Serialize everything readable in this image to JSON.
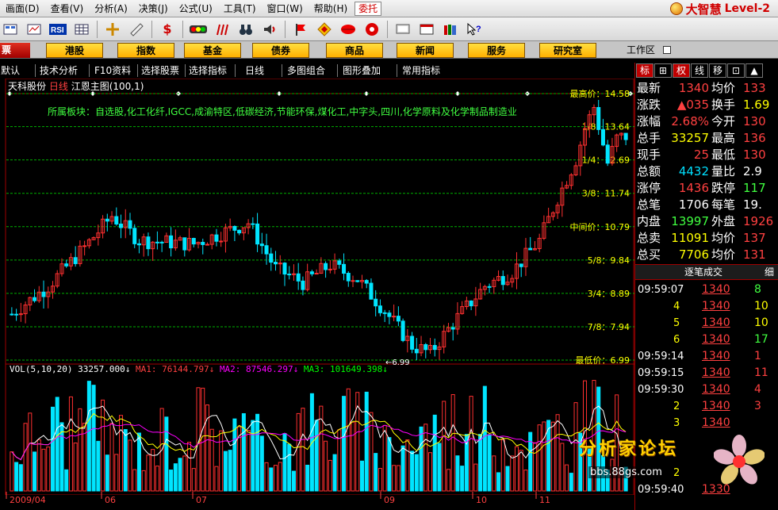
{
  "menu": [
    "画面(D)",
    "查看(V)",
    "分析(A)",
    "决策(J)",
    "公式(U)",
    "工具(T)",
    "窗口(W)",
    "帮助(H)"
  ],
  "menu_special": "委托",
  "brand": {
    "name": "大智慧",
    "edition": "Level-2"
  },
  "toolbar_icons": [
    "layout-icon",
    "ta-icon",
    "rsi-icon",
    "table-icon",
    "crosshair-icon",
    "ruler-icon",
    "dollar-icon",
    "traffic-light-icon",
    "bars-icon",
    "binoculars-icon",
    "speaker-icon",
    "flag-icon",
    "diamond-icon",
    "lips-icon",
    "disc-icon",
    "monitor-icon",
    "book-icon",
    "help-cursor-icon"
  ],
  "nav": {
    "left_label": "票",
    "buttons": [
      "港股",
      "指数",
      "基金",
      "债券",
      "商品",
      "新闻",
      "服务",
      "研究室"
    ],
    "work_zone": "工作区"
  },
  "subbar": [
    "默认",
    "技术分析",
    "F10资料",
    "选择股票",
    "选择指标",
    "日线",
    "多图组合",
    "图形叠加",
    "常用指标"
  ],
  "chart_title": {
    "stock": "天科股份",
    "period": "日线",
    "indicator": "江恩主图(100,1)"
  },
  "sector": "所属板块：自选股,化工化纤,IGCC,成渝特区,低碳经济,节能环保,煤化工,中字头,四川,化学原料及化学制品制造业",
  "gann_levels": [
    {
      "label": "最高价",
      "value": "14.58"
    },
    {
      "label": "1/8",
      "value": "13.64"
    },
    {
      "label": "1/4",
      "value": "12.69"
    },
    {
      "label": "3/8",
      "value": "11.74"
    },
    {
      "label": "中间价",
      "value": "10.79"
    },
    {
      "label": "5/8",
      "value": "9.84"
    },
    {
      "label": "3/4",
      "value": "8.89"
    },
    {
      "label": "7/8",
      "value": "7.94"
    },
    {
      "label": "最低价",
      "value": "6.99"
    }
  ],
  "low_marker": "6.99",
  "vol_legend": {
    "vol": "VOL(5,10,20)",
    "vol_value": "33257.000↓",
    "ma1": "MA1: 76144.797↓",
    "ma2": "MA2: 87546.297↓",
    "ma3": "MA3: 101649.398↓"
  },
  "x_labels": [
    "2009/04",
    "06",
    "07",
    "09",
    "10",
    "11"
  ],
  "right_tabs": [
    "标",
    "⊞",
    "权",
    "线",
    "移",
    "⊡",
    "▲"
  ],
  "quote": [
    {
      "l1": "最新",
      "v1": "1340",
      "c1": "#ff4040",
      "l2": "均价",
      "v2": "133",
      "c2": "#ff4040"
    },
    {
      "l1": "涨跌",
      "v1": "▲035",
      "c1": "#ff4040",
      "l2": "换手",
      "v2": "1.69",
      "c2": "#ffff00"
    },
    {
      "l1": "涨幅",
      "v1": "2.68%",
      "c1": "#ff4040",
      "l2": "今开",
      "v2": "130",
      "c2": "#ff4040"
    },
    {
      "l1": "总手",
      "v1": "33257",
      "c1": "#ffff00",
      "l2": "最高",
      "v2": "136",
      "c2": "#ff4040"
    },
    {
      "l1": "现手",
      "v1": "25",
      "c1": "#ff4040",
      "l2": "最低",
      "v2": "130",
      "c2": "#ff4040"
    },
    {
      "l1": "总额",
      "v1": "4432",
      "c1": "#00e0ff",
      "l2": "量比",
      "v2": "2.9",
      "c2": "#ffffff"
    },
    {
      "l1": "涨停",
      "v1": "1436",
      "c1": "#ff4040",
      "l2": "跌停",
      "v2": "117",
      "c2": "#40ff40"
    },
    {
      "l1": "总笔",
      "v1": "1706",
      "c1": "#ffffff",
      "l2": "每笔",
      "v2": "19.",
      "c2": "#ffffff"
    },
    {
      "l1": "内盘",
      "v1": "13997",
      "c1": "#40ff40",
      "l2": "外盘",
      "v2": "1926",
      "c2": "#ff4040"
    },
    {
      "l1": "总卖",
      "v1": "11091",
      "c1": "#ffff00",
      "l2": "均价",
      "v2": "137",
      "c2": "#ff4040"
    },
    {
      "l1": "总买",
      "v1": "7706",
      "c1": "#ffff00",
      "l2": "均价",
      "v2": "131",
      "c2": "#ff4040"
    }
  ],
  "ticks_title": "逐笔成交",
  "ticks_extra": "细",
  "ticks": [
    {
      "time": "09:59:07",
      "price": "1340",
      "vol": "8",
      "vc": "#40ff40"
    },
    {
      "time": "4",
      "price": "1340",
      "vol": "10",
      "vc": "#ffff00"
    },
    {
      "time": "5",
      "price": "1340",
      "vol": "10",
      "vc": "#ffff00"
    },
    {
      "time": "6",
      "price": "1340",
      "vol": "17",
      "vc": "#40ff40"
    },
    {
      "time": "09:59:14",
      "price": "1340",
      "vol": "1",
      "vc": "#ff4040"
    },
    {
      "time": "09:59:15",
      "price": "1340",
      "vol": "11",
      "vc": "#ff4040"
    },
    {
      "time": "09:59:30",
      "price": "1340",
      "vol": "4",
      "vc": "#ff4040"
    },
    {
      "time": "2",
      "price": "1340",
      "vol": "3",
      "vc": "#ff4040"
    },
    {
      "time": "3",
      "price": "1340",
      "vol": "",
      "vc": "#ff4040"
    },
    {
      "time": "",
      "price": "",
      "vol": "",
      "vc": "#ff4040"
    },
    {
      "time": "",
      "price": "",
      "vol": "",
      "vc": "#ff4040"
    },
    {
      "time": "2",
      "price": "",
      "vol": "",
      "vc": "#ff4040"
    },
    {
      "time": "09:59:40",
      "price": "1330",
      "vol": "",
      "vc": "#ff4040"
    }
  ],
  "watermark": {
    "title": "分析家论坛",
    "url": "bbs.88gs.com"
  },
  "colors": {
    "up": "#ff3030",
    "down": "#00e5ff",
    "grid": "#00b000",
    "gann_label": "#ffff00",
    "ma1": "#ffffff",
    "ma2": "#ffff00",
    "ma3": "#ff00ff"
  }
}
